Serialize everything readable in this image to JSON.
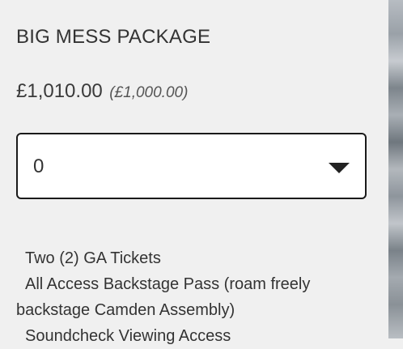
{
  "product": {
    "title": "BIG MESS PACKAGE",
    "price": "£1,010.00",
    "original_price": "(£1,000.00)"
  },
  "quantity_select": {
    "value": "0",
    "icon": "chevron-down-icon"
  },
  "description": {
    "items": [
      "Two (2) GA Tickets",
      "All Access Backstage Pass (roam freely backstage Camden Assembly)",
      "Soundcheck Viewing Access"
    ]
  },
  "colors": {
    "background": "#f0f0f0",
    "text": "#333333",
    "select_border": "#1a1a1a"
  }
}
